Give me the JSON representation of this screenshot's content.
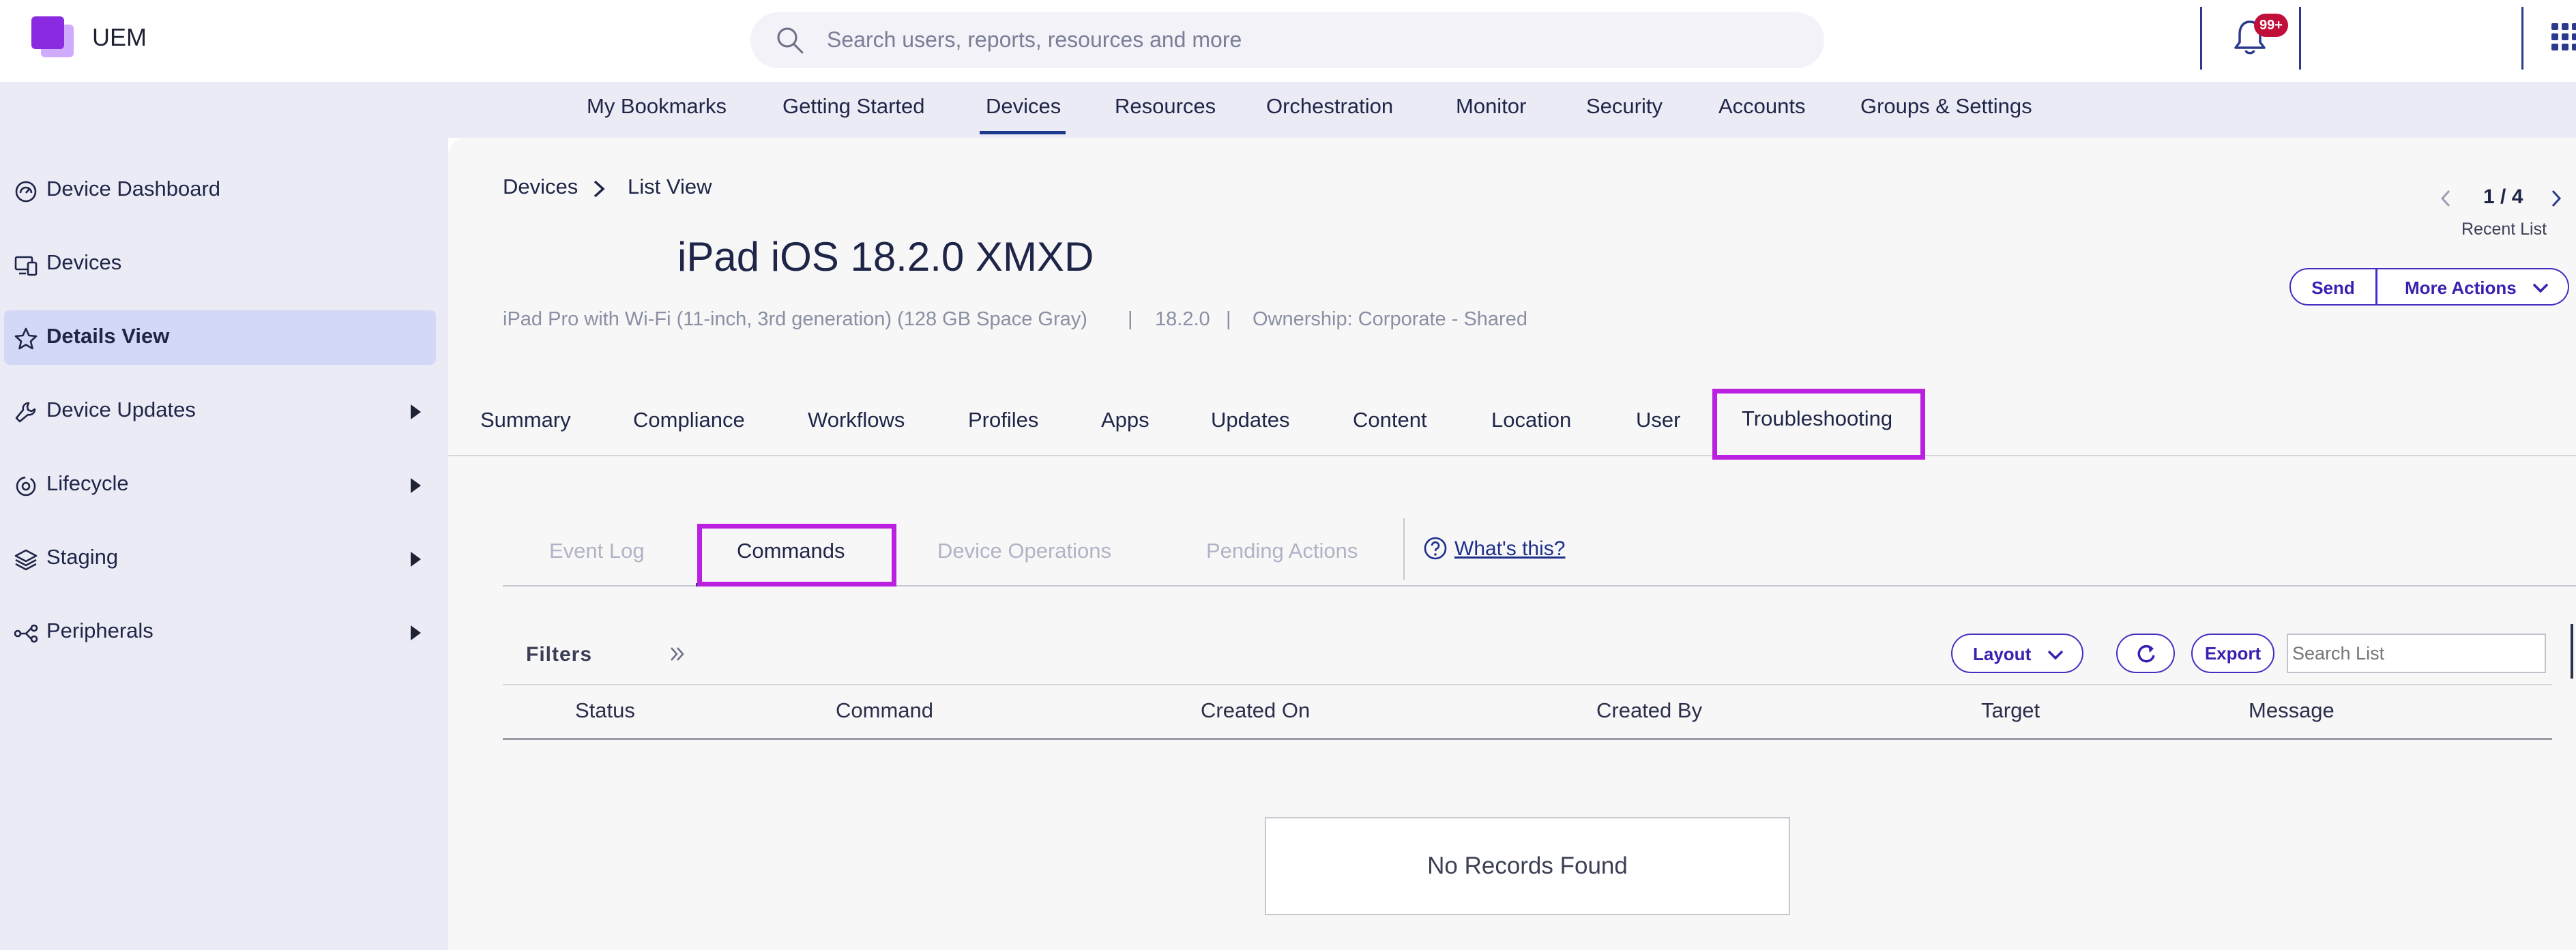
{
  "app": {
    "title": "UEM"
  },
  "search": {
    "placeholder": "Search users, reports, resources and more"
  },
  "notifications": {
    "badge": "99+"
  },
  "nav": {
    "items": [
      {
        "label": "My Bookmarks"
      },
      {
        "label": "Getting Started"
      },
      {
        "label": "Devices",
        "active": true
      },
      {
        "label": "Resources"
      },
      {
        "label": "Orchestration"
      },
      {
        "label": "Monitor"
      },
      {
        "label": "Security"
      },
      {
        "label": "Accounts"
      },
      {
        "label": "Groups & Settings"
      }
    ]
  },
  "sidebar": {
    "items": [
      {
        "label": "Device Dashboard",
        "icon": "dashboard-icon"
      },
      {
        "label": "Devices",
        "icon": "devices-icon"
      },
      {
        "label": "Details View",
        "icon": "star-icon",
        "active": true
      },
      {
        "label": "Device Updates",
        "icon": "wrench-icon",
        "expandable": true
      },
      {
        "label": "Lifecycle",
        "icon": "lifecycle-icon",
        "expandable": true
      },
      {
        "label": "Staging",
        "icon": "layers-icon",
        "expandable": true
      },
      {
        "label": "Peripherals",
        "icon": "peripherals-icon",
        "expandable": true
      }
    ]
  },
  "breadcrumb": {
    "parent": "Devices",
    "current": "List View"
  },
  "device": {
    "title": "iPad iOS 18.2.0 XMXD",
    "model": "iPad Pro with Wi-Fi (11-inch, 3rd generation) (128 GB Space Gray)",
    "sep1": "|",
    "os_version": "18.2.0",
    "sep2": "|",
    "ownership": "Ownership: Corporate - Shared"
  },
  "pager": {
    "count": "1 / 4",
    "label": "Recent List"
  },
  "actions": {
    "send": "Send",
    "more": "More Actions"
  },
  "tabs": [
    {
      "label": "Summary"
    },
    {
      "label": "Compliance"
    },
    {
      "label": "Workflows"
    },
    {
      "label": "Profiles"
    },
    {
      "label": "Apps"
    },
    {
      "label": "Updates"
    },
    {
      "label": "Content"
    },
    {
      "label": "Location"
    },
    {
      "label": "User"
    },
    {
      "label": "Troubleshooting",
      "active": true
    }
  ],
  "subtabs": [
    {
      "label": "Event Log"
    },
    {
      "label": "Commands",
      "active": true
    },
    {
      "label": "Device Operations"
    },
    {
      "label": "Pending Actions"
    }
  ],
  "help": {
    "label": "What's this?"
  },
  "toolbar": {
    "filters": "Filters",
    "layout": "Layout",
    "export": "Export",
    "search_placeholder": "Search List"
  },
  "grid": {
    "columns": [
      "Status",
      "Command",
      "Created On",
      "Created By",
      "Target",
      "Message"
    ],
    "empty": "No Records Found"
  },
  "colors": {
    "accent": "#1e3a8a",
    "button": "#4a2bc2",
    "highlight": "#bb1fe0",
    "badge": "#c0103a",
    "sidebar_bg": "#ebebf5",
    "sidebar_active": "#d2d8f6"
  }
}
